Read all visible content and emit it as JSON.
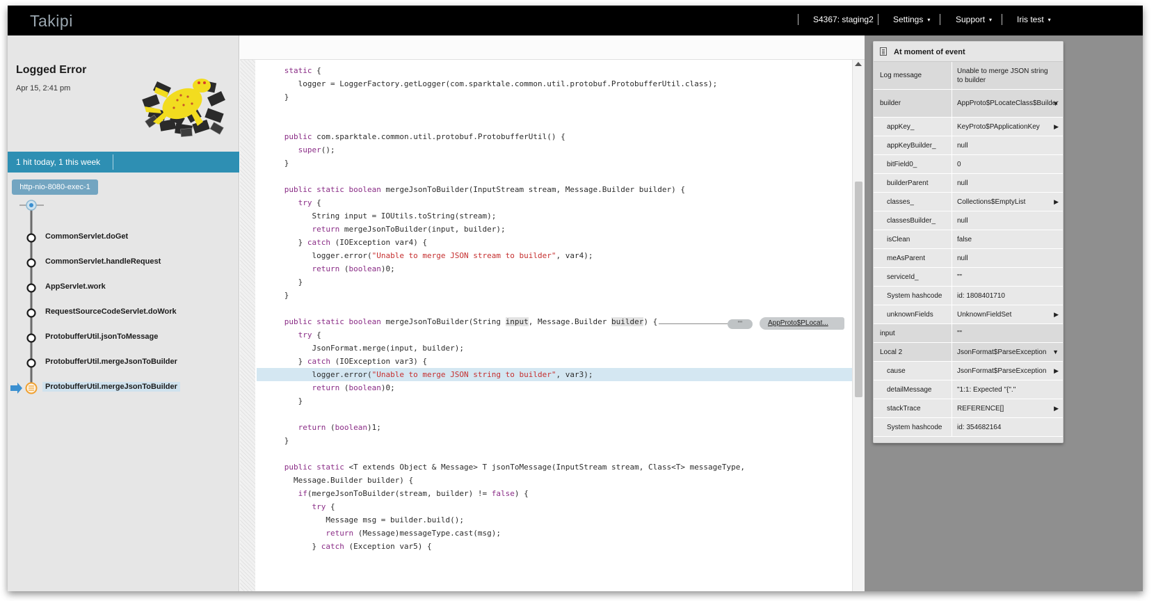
{
  "topbar": {
    "logo": "Takipi",
    "server": "S4367: staging2",
    "settings": "Settings",
    "support": "Support",
    "user": "Iris test",
    "caret": "▾"
  },
  "left": {
    "title": "Logged Error",
    "date": "Apr 15, 2:41 pm",
    "hits": "1 hit today, 1 this week",
    "thread": "http-nio-8080-exec-1",
    "frames": [
      "CommonServlet.doGet",
      "CommonServlet.handleRequest",
      "AppServlet.work",
      "RequestSourceCodeServlet.doWork",
      "ProtobufferUtil.jsonToMessage",
      "ProtobufferUtil.mergeJsonToBuilder",
      "ProtobufferUtil.mergeJsonToBuilder"
    ]
  },
  "code": {
    "lines": [
      "      static {",
      "         logger = LoggerFactory.getLogger(com.sparktale.common.util.protobuf.ProtobufferUtil.class);",
      "      }",
      "",
      "",
      "      public com.sparktale.common.util.protobuf.ProtobufferUtil() {",
      "         super();",
      "      }",
      "",
      "      public static boolean mergeJsonToBuilder(InputStream stream, Message.Builder builder) {",
      "         try {",
      "            String input = IOUtils.toString(stream);",
      "            return mergeJsonToBuilder(input, builder);",
      "         } catch (IOException var4) {",
      "            logger.error(\"Unable to merge JSON stream to builder\", var4);",
      "            return (boolean)0;",
      "         }",
      "      }",
      "",
      "      public static boolean mergeJsonToBuilder(String input, Message.Builder builder) {",
      "         try {",
      "            JsonFormat.merge(input, builder);",
      "         } catch (IOException var3) {",
      "            logger.error(\"Unable to merge JSON string to builder\", var3);",
      "            return (boolean)0;",
      "         }",
      "",
      "         return (boolean)1;",
      "      }",
      "",
      "      public static <T extends Object & Message> T jsonToMessage(InputStream stream, Class<T> messageType,",
      "        Message.Builder builder) {",
      "         if(mergeJsonToBuilder(stream, builder) != false) {",
      "            try {",
      "               Message msg = builder.build();",
      "               return (Message)messageType.cast(msg);",
      "            } catch (Exception var5) {"
    ],
    "highlight_line": 23,
    "callout_quote": "\"\"",
    "callout_value": "AppProto$PLocat..."
  },
  "variables": {
    "header": "At moment of event",
    "rows": [
      {
        "key": "Log message",
        "value": "Unable to merge JSON string to builder",
        "level": "top",
        "arrow": ""
      },
      {
        "key": "builder",
        "value": "AppProto$PLocateClass$Builder",
        "level": "top",
        "arrow": "▼"
      },
      {
        "key": "appKey_",
        "value": "KeyProto$PApplicationKey",
        "level": "child",
        "arrow": "▶"
      },
      {
        "key": "appKeyBuilder_",
        "value": "null",
        "level": "child",
        "arrow": ""
      },
      {
        "key": "bitField0_",
        "value": "0",
        "level": "child",
        "arrow": ""
      },
      {
        "key": "builderParent",
        "value": "null",
        "level": "child",
        "arrow": ""
      },
      {
        "key": "classes_",
        "value": "Collections$EmptyList",
        "level": "child",
        "arrow": "▶"
      },
      {
        "key": "classesBuilder_",
        "value": "null",
        "level": "child",
        "arrow": ""
      },
      {
        "key": "isClean",
        "value": "false",
        "level": "child",
        "arrow": ""
      },
      {
        "key": "meAsParent",
        "value": "null",
        "level": "child",
        "arrow": ""
      },
      {
        "key": "serviceId_",
        "value": "\"\"",
        "level": "child",
        "arrow": ""
      },
      {
        "key": "System hashcode",
        "value": "id: 1808401710",
        "level": "child",
        "arrow": ""
      },
      {
        "key": "unknownFields",
        "value": "UnknownFieldSet",
        "level": "child",
        "arrow": "▶"
      },
      {
        "key": "input",
        "value": "\"\"",
        "level": "top",
        "arrow": ""
      },
      {
        "key": "Local 2",
        "value": "JsonFormat$ParseException",
        "level": "top",
        "arrow": "▼"
      },
      {
        "key": "cause",
        "value": "JsonFormat$ParseException",
        "level": "child",
        "arrow": "▶"
      },
      {
        "key": "detailMessage",
        "value": "\"1:1: Expected \"{\".\"",
        "level": "child",
        "arrow": ""
      },
      {
        "key": "stackTrace",
        "value": "REFERENCE[]",
        "level": "child",
        "arrow": "▶"
      },
      {
        "key": "System hashcode",
        "value": "id: 354682164",
        "level": "child",
        "arrow": ""
      }
    ]
  },
  "colors": {
    "accent": "#2e8fb3",
    "thread_tag": "#73a5c1",
    "current_frame": "#f0a030",
    "current_arrow": "#3a8fd0",
    "keyword": "#8a2c86",
    "string": "#c52f2f"
  }
}
